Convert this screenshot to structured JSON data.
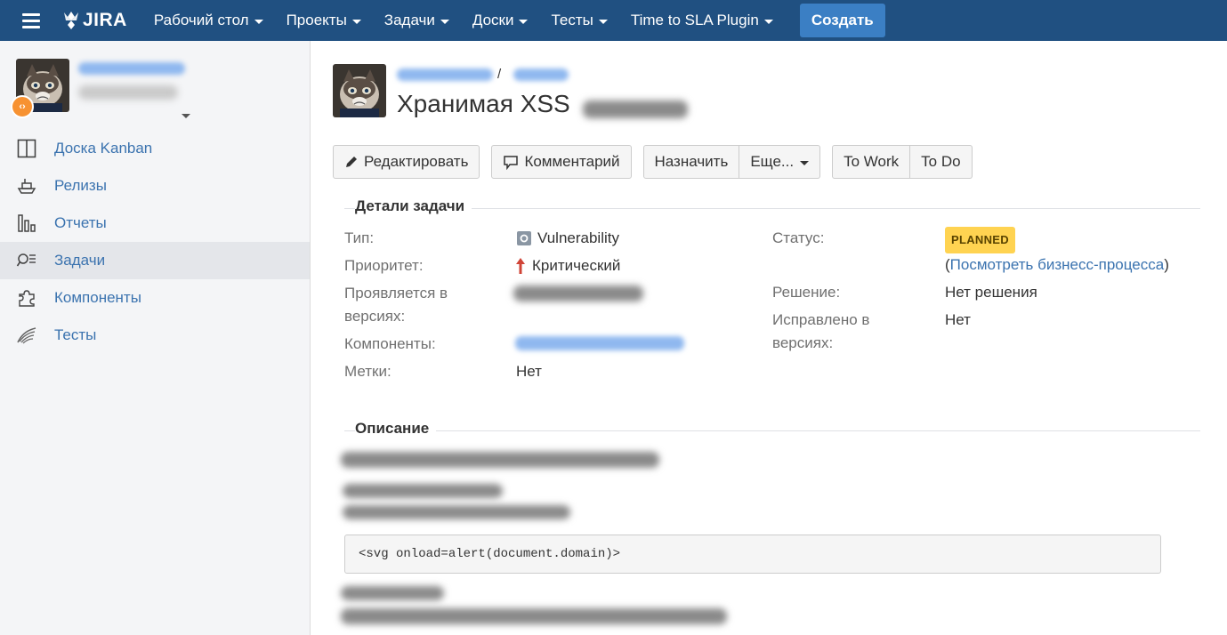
{
  "header": {
    "logo_text": "JIRA",
    "nav": [
      {
        "label": "Рабочий стол"
      },
      {
        "label": "Проекты"
      },
      {
        "label": "Задачи"
      },
      {
        "label": "Доски"
      },
      {
        "label": "Тесты"
      },
      {
        "label": "Time to SLA Plugin"
      }
    ],
    "create_label": "Создать",
    "colors": {
      "bar": "#205081",
      "create": "#3b7fc4"
    }
  },
  "sidebar": {
    "badge": "‹›",
    "items": [
      {
        "label": "Доска Kanban",
        "icon": "board-icon"
      },
      {
        "label": "Релизы",
        "icon": "ship-icon"
      },
      {
        "label": "Отчеты",
        "icon": "chart-icon"
      },
      {
        "label": "Задачи",
        "icon": "issues-search-icon",
        "active": true
      },
      {
        "label": "Компоненты",
        "icon": "puzzle-icon"
      },
      {
        "label": "Тесты",
        "icon": "wing-icon"
      }
    ]
  },
  "issue": {
    "breadcrumb_sep": "/",
    "title": "Хранимая XSS",
    "toolbar": {
      "edit": "Редактировать",
      "comment": "Комментарий",
      "assign": "Назначить",
      "more": "Еще...",
      "to_work": "To Work",
      "to_do": "To Do"
    },
    "details": {
      "heading": "Детали задачи",
      "type_label": "Тип:",
      "type_value": "Vulnerability",
      "priority_label": "Приоритет:",
      "priority_value": "Критический",
      "affects_label": "Проявляется в версиях:",
      "components_label": "Компоненты:",
      "labels_label": "Метки:",
      "labels_value": "Нет",
      "status_label": "Статус:",
      "status_value": "PLANNED",
      "workflow_open": "(",
      "workflow_link": "Посмотреть бизнесс-процесса",
      "workflow_close": ")",
      "resolution_label": "Решение:",
      "resolution_value": "Нет решения",
      "fix_label": "Исправлено в версиях:",
      "fix_value": "Нет"
    },
    "description": {
      "heading": "Описание",
      "code": "<svg onload=alert(document.domain)>"
    }
  }
}
